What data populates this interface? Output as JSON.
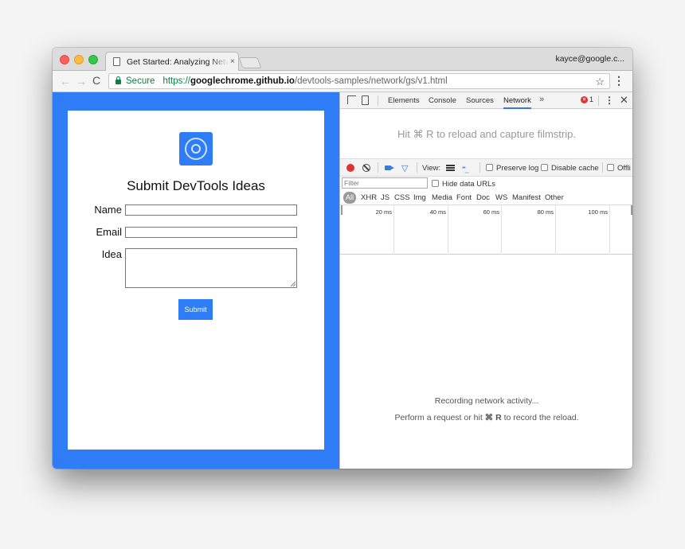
{
  "window": {
    "tab_title": "Get Started: Analyzing Network",
    "tab_close": "×",
    "profile": "kayce@google.c..."
  },
  "toolbar": {
    "back": "←",
    "forward": "→",
    "reload": "C",
    "secure_label": "Secure",
    "url_scheme": "https://",
    "url_host": "googlechrome.github.io",
    "url_path": "/devtools-samples/network/gs/v1.html",
    "star": "☆",
    "menu": "⋮"
  },
  "page": {
    "title": "Submit DevTools Ideas",
    "name_label": "Name",
    "email_label": "Email",
    "idea_label": "Idea",
    "submit_label": "Submit"
  },
  "devtools": {
    "tabs": [
      "Elements",
      "Console",
      "Sources",
      "Network"
    ],
    "active_tab": "Network",
    "more": "»",
    "error_count": "1",
    "kebab": "⋮",
    "close": "✕",
    "filmstrip_msg": "Hit ⌘ R to reload and capture filmstrip.",
    "view_label": "View:",
    "preserve_log": "Preserve log",
    "disable_cache": "Disable cache",
    "offline": "Offli",
    "filter_placeholder": "Filter",
    "hide_data_urls": "Hide data URLs",
    "types": [
      "All",
      "XHR",
      "JS",
      "CSS",
      "Img",
      "Media",
      "Font",
      "Doc",
      "WS",
      "Manifest",
      "Other"
    ],
    "ticks": [
      "20 ms",
      "40 ms",
      "60 ms",
      "80 ms",
      "100 ms"
    ],
    "recording_msg": "Recording network activity...",
    "perform_pre": "Perform a request or hit ",
    "perform_key": "⌘ R",
    "perform_post": " to record the reload."
  },
  "colors": {
    "page_blue": "#2e7cf6",
    "secure_green": "#0b8043",
    "record_red": "#e0332f",
    "devtools_accent": "#3879d9"
  }
}
